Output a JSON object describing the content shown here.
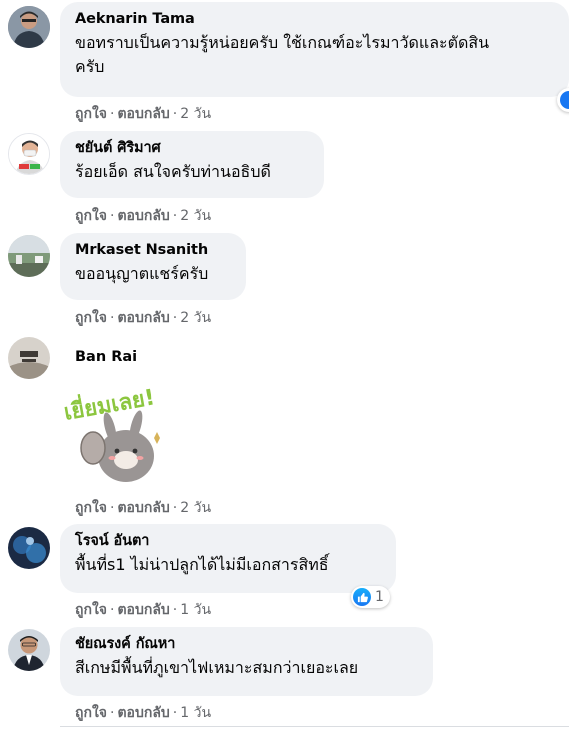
{
  "labels": {
    "like": "ถูกใจ",
    "reply": "ตอบกลับ",
    "sep": "·"
  },
  "comments": [
    {
      "author": "Aeknarin Tama",
      "line1": "ขอทราบเป็นความรู้หน่อยครับ ใช้เกณฑ์อะไรมาวัดและตัดสิน",
      "line2": "ครับ",
      "time": "2 วัน"
    },
    {
      "author": "ชยันต์ ศิริมาศ",
      "text": "ร้อยเอ็ด สนใจครับท่านอธิบดี",
      "time": "2 วัน"
    },
    {
      "author": "Mrkaset Nsanith",
      "text": "ขออนุญาตแชร์ครับ",
      "time": "2 วัน"
    },
    {
      "author": "Ban Rai",
      "sticker_text": "เยี่ยมเลย!",
      "time": "2 วัน"
    },
    {
      "author": "โรจน์ อันตา",
      "text": "พื้นที่s1 ไม่น่าปลูกได้ไม่มีเอกสารสิทธิ์",
      "time": "1 วัน",
      "reaction_count": "1"
    },
    {
      "author": "ชัยณรงค์ กัณหา",
      "text": "สีเกษมีพื้นที่ภูเขาไฟเหมาะสมกว่าเยอะเลย",
      "time": "1 วัน"
    }
  ],
  "colors": {
    "bubble": "#f0f2f5",
    "meta": "#65676b",
    "like_blue": "#1877f2"
  }
}
